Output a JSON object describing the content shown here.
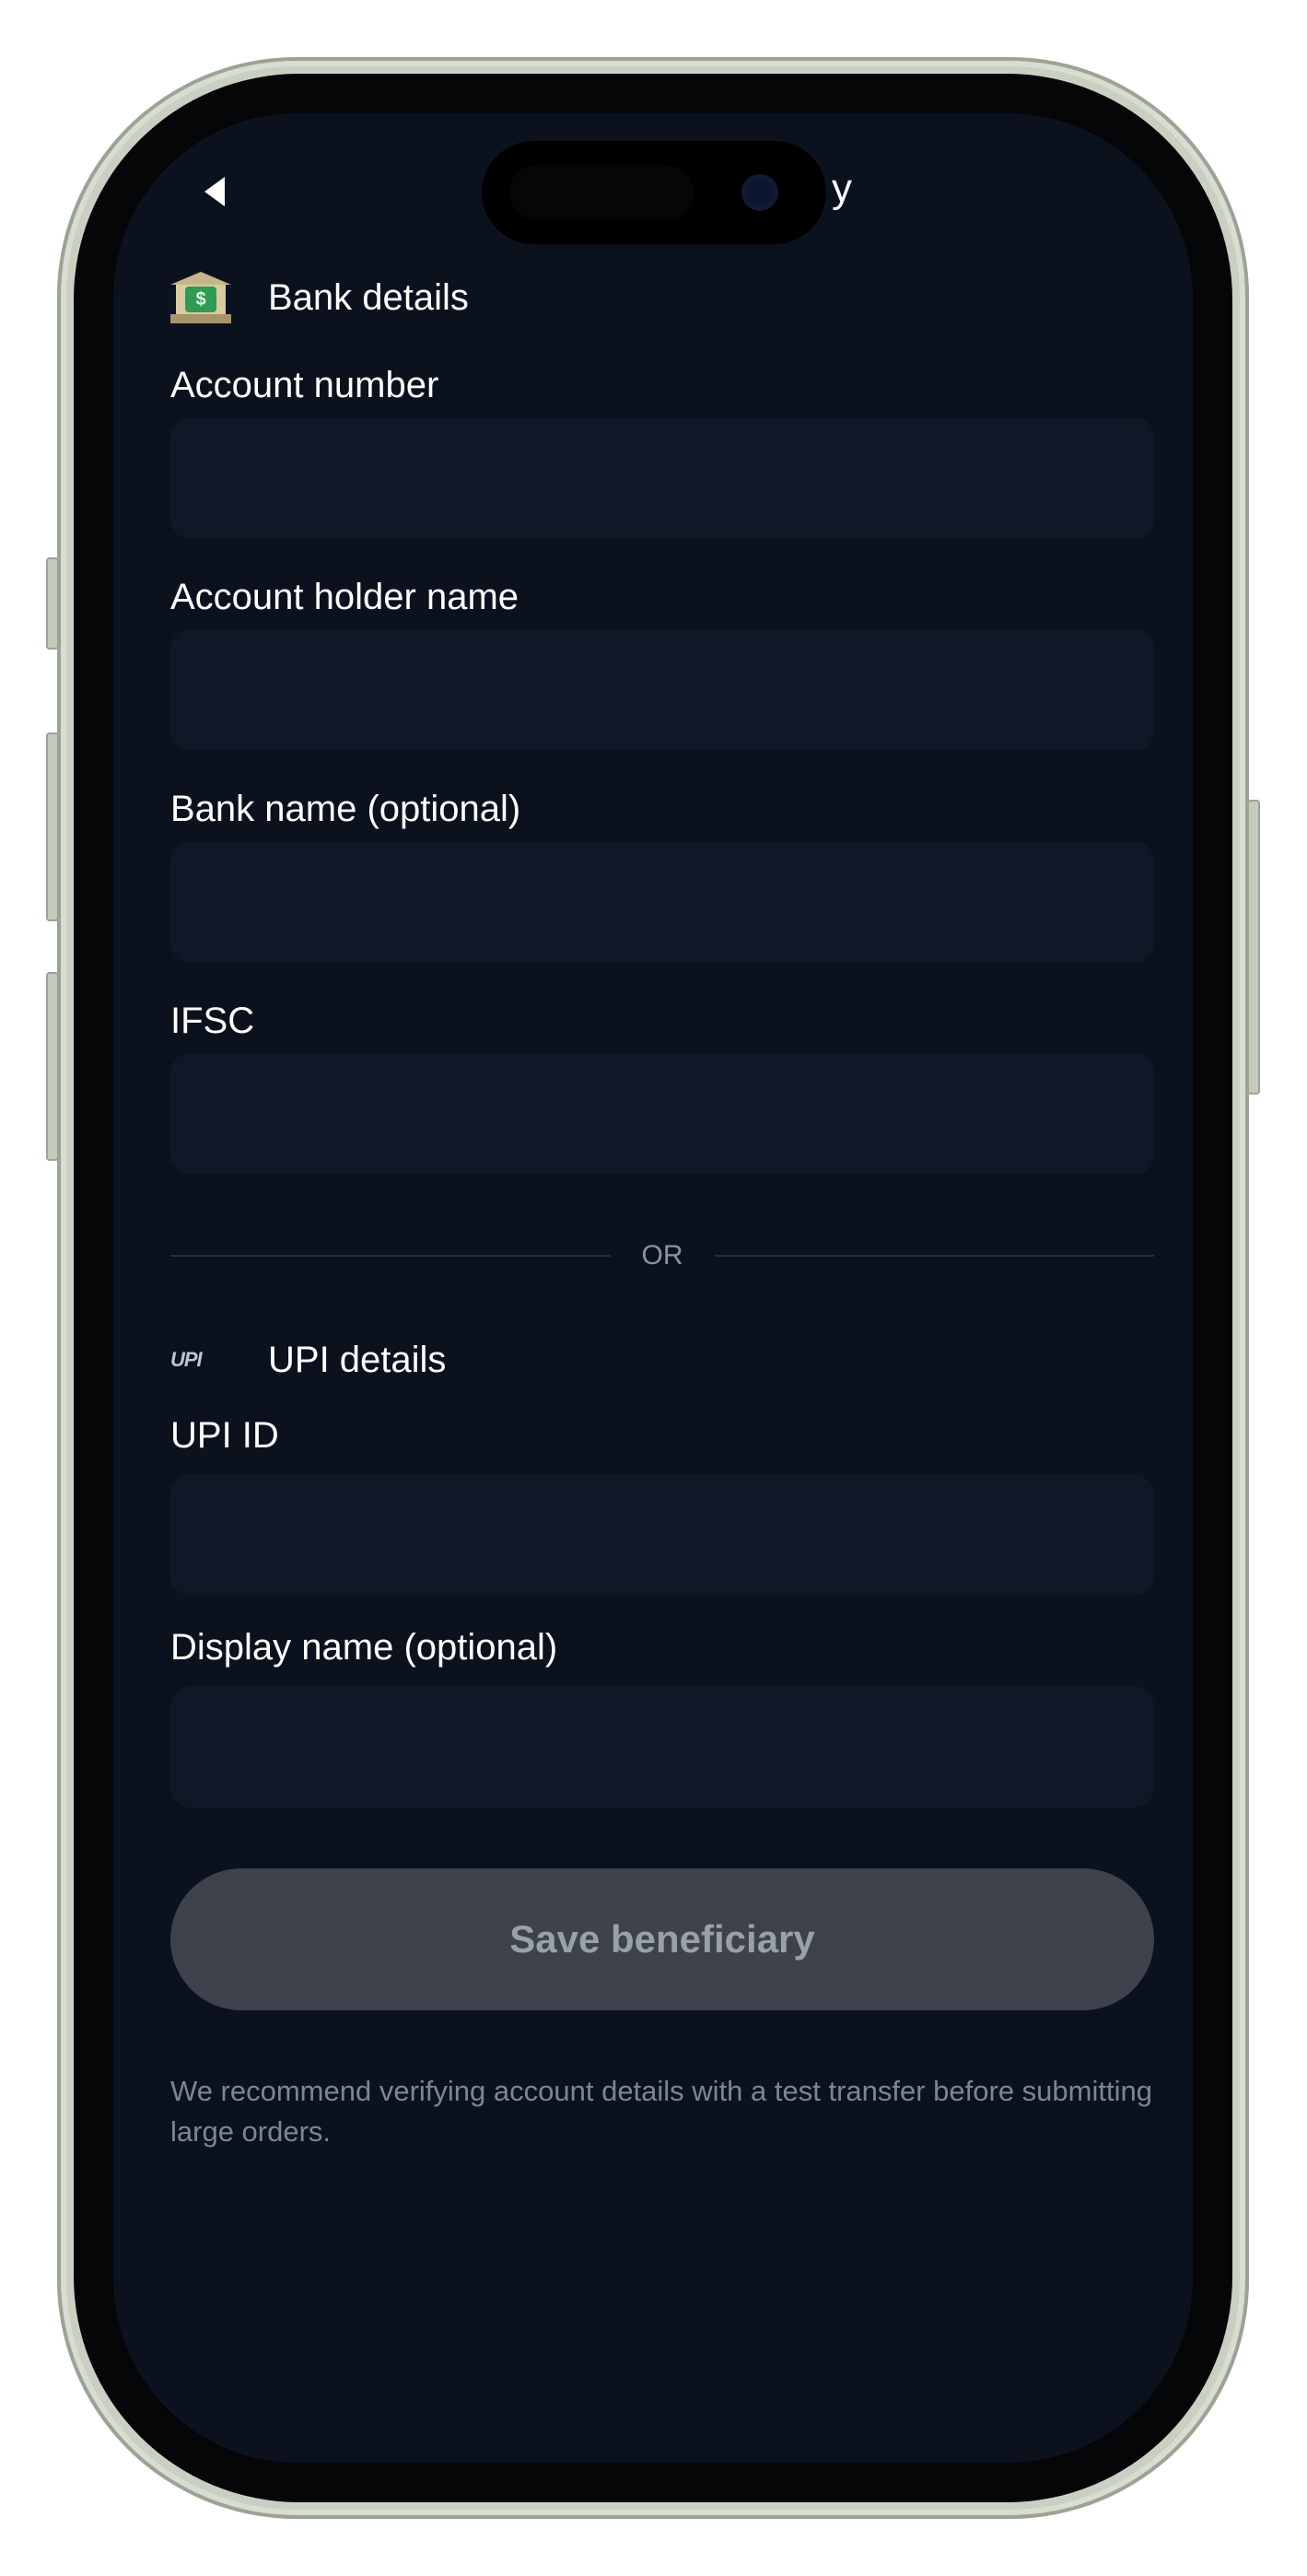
{
  "header": {
    "back_icon": "back-arrow-icon",
    "title_visible_fragment": "y"
  },
  "bank_section": {
    "icon": "bank-icon",
    "icon_glyph": "$",
    "title": "Bank details",
    "fields": [
      {
        "label": "Account number",
        "value": "",
        "placeholder": ""
      },
      {
        "label": "Account holder name",
        "value": "",
        "placeholder": ""
      },
      {
        "label": "Bank name (optional)",
        "value": "",
        "placeholder": ""
      },
      {
        "label": "IFSC",
        "value": "",
        "placeholder": ""
      }
    ]
  },
  "divider": {
    "label": "OR"
  },
  "upi_section": {
    "icon": "upi-logo-icon",
    "icon_text": "UPI",
    "title": "UPI details",
    "fields": [
      {
        "label": "UPI ID",
        "value": "",
        "placeholder": ""
      },
      {
        "label": "Display name (optional)",
        "value": "",
        "placeholder": ""
      }
    ]
  },
  "actions": {
    "save_label": "Save beneficiary",
    "save_enabled": false
  },
  "footer_note": "We recommend verifying account details with a test transfer before submitting large orders.",
  "colors": {
    "screen_background": "#0c121d",
    "input_background": "#101727",
    "button_disabled": "#3d424d",
    "text_primary": "#ffffff",
    "text_muted": "#7d8595"
  }
}
